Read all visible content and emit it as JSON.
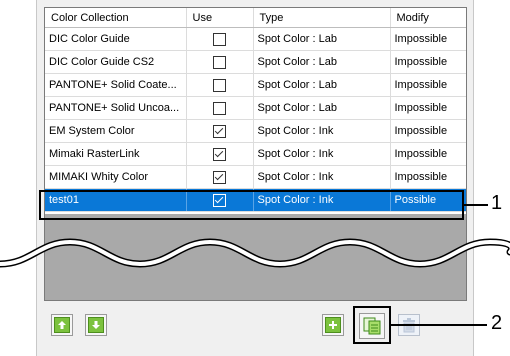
{
  "table": {
    "headers": {
      "collection": "Color Collection",
      "use": "Use",
      "type": "Type",
      "modify": "Modify"
    },
    "rows": [
      {
        "name": "DIC Color Guide",
        "use": false,
        "type": "Spot Color : Lab",
        "modify": "Impossible"
      },
      {
        "name": "DIC Color Guide CS2",
        "use": false,
        "type": "Spot Color : Lab",
        "modify": "Impossible"
      },
      {
        "name": "PANTONE+ Solid Coate...",
        "use": false,
        "type": "Spot Color : Lab",
        "modify": "Impossible"
      },
      {
        "name": "PANTONE+ Solid Uncoa...",
        "use": false,
        "type": "Spot Color : Lab",
        "modify": "Impossible"
      },
      {
        "name": "EM System Color",
        "use": true,
        "type": "Spot Color : Ink",
        "modify": "Impossible"
      },
      {
        "name": "Mimaki RasterLink",
        "use": true,
        "type": "Spot Color : Ink",
        "modify": "Impossible"
      },
      {
        "name": "MIMAKI Whity Color",
        "use": true,
        "type": "Spot Color : Ink",
        "modify": "Impossible"
      },
      {
        "name": "test01",
        "use": true,
        "type": "Spot Color : Ink",
        "modify": "Possible",
        "selected": true
      }
    ]
  },
  "callouts": {
    "one": "1",
    "two": "2"
  },
  "icons": {
    "move_up": "arrow-up-icon",
    "move_down": "arrow-down-icon",
    "add": "plus-icon",
    "duplicate": "copy-icon",
    "delete": "trash-icon"
  },
  "colors": {
    "selection": "#0a78d7",
    "button_green": "#7cc23e",
    "wave": "#e02020"
  }
}
